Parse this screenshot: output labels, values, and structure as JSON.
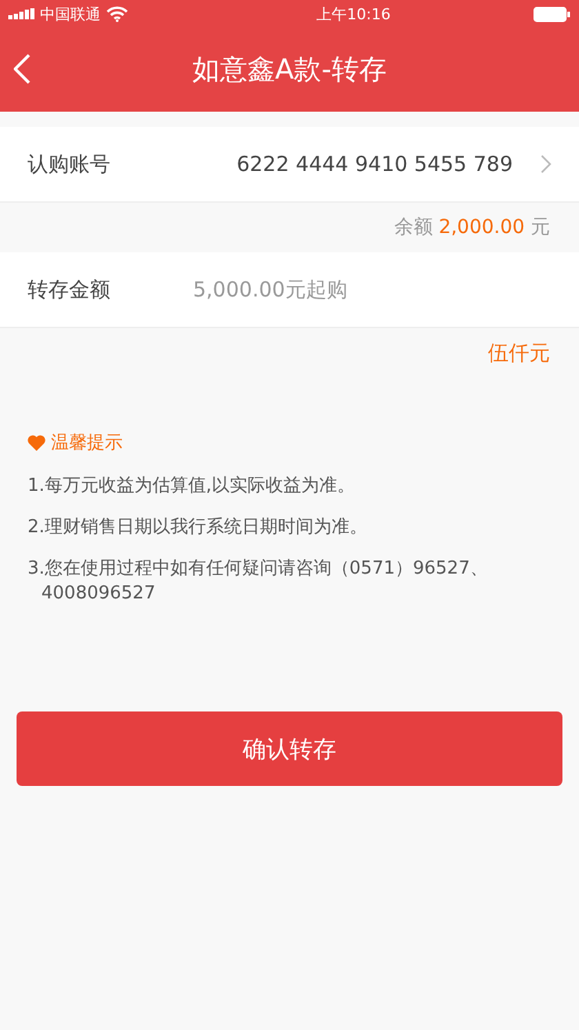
{
  "status_bar": {
    "carrier": "中国联通",
    "time": "上午10:16"
  },
  "nav": {
    "title": "如意鑫A款-转存"
  },
  "account": {
    "label": "认购账号",
    "value": "6222 4444 9410 5455 789"
  },
  "balance": {
    "label": "余额",
    "amount": "2,000.00",
    "unit": "元"
  },
  "amount_field": {
    "label": "转存金额",
    "placeholder": "5,000.00元起购"
  },
  "amount_words": "伍仟元",
  "tips": {
    "title": "温馨提示",
    "items": [
      "1.每万元收益为估算值,以实际收益为准。",
      "2.理财销售日期以我行系统日期时间为准。",
      "3.您在使用过程中如有任何疑问请咨询（0571）96527、4008096527"
    ]
  },
  "confirm_button": "确认转存"
}
